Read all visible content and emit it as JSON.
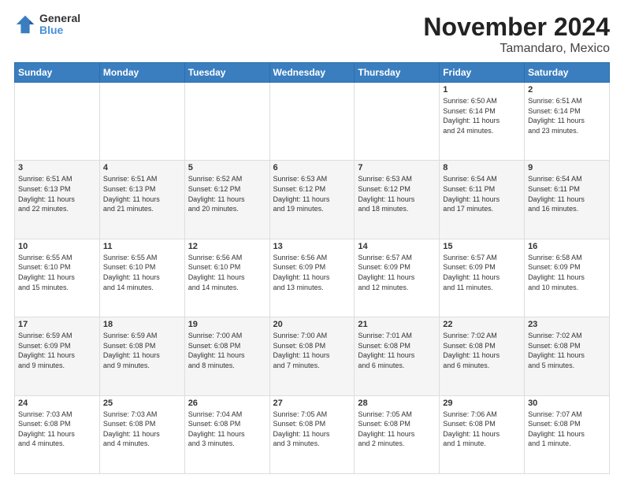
{
  "header": {
    "logo": {
      "general": "General",
      "blue": "Blue"
    },
    "title": "November 2024",
    "subtitle": "Tamandaro, Mexico"
  },
  "calendar": {
    "days_of_week": [
      "Sunday",
      "Monday",
      "Tuesday",
      "Wednesday",
      "Thursday",
      "Friday",
      "Saturday"
    ],
    "weeks": [
      [
        {
          "day": "",
          "info": ""
        },
        {
          "day": "",
          "info": ""
        },
        {
          "day": "",
          "info": ""
        },
        {
          "day": "",
          "info": ""
        },
        {
          "day": "",
          "info": ""
        },
        {
          "day": "1",
          "info": "Sunrise: 6:50 AM\nSunset: 6:14 PM\nDaylight: 11 hours\nand 24 minutes."
        },
        {
          "day": "2",
          "info": "Sunrise: 6:51 AM\nSunset: 6:14 PM\nDaylight: 11 hours\nand 23 minutes."
        }
      ],
      [
        {
          "day": "3",
          "info": "Sunrise: 6:51 AM\nSunset: 6:13 PM\nDaylight: 11 hours\nand 22 minutes."
        },
        {
          "day": "4",
          "info": "Sunrise: 6:51 AM\nSunset: 6:13 PM\nDaylight: 11 hours\nand 21 minutes."
        },
        {
          "day": "5",
          "info": "Sunrise: 6:52 AM\nSunset: 6:12 PM\nDaylight: 11 hours\nand 20 minutes."
        },
        {
          "day": "6",
          "info": "Sunrise: 6:53 AM\nSunset: 6:12 PM\nDaylight: 11 hours\nand 19 minutes."
        },
        {
          "day": "7",
          "info": "Sunrise: 6:53 AM\nSunset: 6:12 PM\nDaylight: 11 hours\nand 18 minutes."
        },
        {
          "day": "8",
          "info": "Sunrise: 6:54 AM\nSunset: 6:11 PM\nDaylight: 11 hours\nand 17 minutes."
        },
        {
          "day": "9",
          "info": "Sunrise: 6:54 AM\nSunset: 6:11 PM\nDaylight: 11 hours\nand 16 minutes."
        }
      ],
      [
        {
          "day": "10",
          "info": "Sunrise: 6:55 AM\nSunset: 6:10 PM\nDaylight: 11 hours\nand 15 minutes."
        },
        {
          "day": "11",
          "info": "Sunrise: 6:55 AM\nSunset: 6:10 PM\nDaylight: 11 hours\nand 14 minutes."
        },
        {
          "day": "12",
          "info": "Sunrise: 6:56 AM\nSunset: 6:10 PM\nDaylight: 11 hours\nand 14 minutes."
        },
        {
          "day": "13",
          "info": "Sunrise: 6:56 AM\nSunset: 6:09 PM\nDaylight: 11 hours\nand 13 minutes."
        },
        {
          "day": "14",
          "info": "Sunrise: 6:57 AM\nSunset: 6:09 PM\nDaylight: 11 hours\nand 12 minutes."
        },
        {
          "day": "15",
          "info": "Sunrise: 6:57 AM\nSunset: 6:09 PM\nDaylight: 11 hours\nand 11 minutes."
        },
        {
          "day": "16",
          "info": "Sunrise: 6:58 AM\nSunset: 6:09 PM\nDaylight: 11 hours\nand 10 minutes."
        }
      ],
      [
        {
          "day": "17",
          "info": "Sunrise: 6:59 AM\nSunset: 6:09 PM\nDaylight: 11 hours\nand 9 minutes."
        },
        {
          "day": "18",
          "info": "Sunrise: 6:59 AM\nSunset: 6:08 PM\nDaylight: 11 hours\nand 9 minutes."
        },
        {
          "day": "19",
          "info": "Sunrise: 7:00 AM\nSunset: 6:08 PM\nDaylight: 11 hours\nand 8 minutes."
        },
        {
          "day": "20",
          "info": "Sunrise: 7:00 AM\nSunset: 6:08 PM\nDaylight: 11 hours\nand 7 minutes."
        },
        {
          "day": "21",
          "info": "Sunrise: 7:01 AM\nSunset: 6:08 PM\nDaylight: 11 hours\nand 6 minutes."
        },
        {
          "day": "22",
          "info": "Sunrise: 7:02 AM\nSunset: 6:08 PM\nDaylight: 11 hours\nand 6 minutes."
        },
        {
          "day": "23",
          "info": "Sunrise: 7:02 AM\nSunset: 6:08 PM\nDaylight: 11 hours\nand 5 minutes."
        }
      ],
      [
        {
          "day": "24",
          "info": "Sunrise: 7:03 AM\nSunset: 6:08 PM\nDaylight: 11 hours\nand 4 minutes."
        },
        {
          "day": "25",
          "info": "Sunrise: 7:03 AM\nSunset: 6:08 PM\nDaylight: 11 hours\nand 4 minutes."
        },
        {
          "day": "26",
          "info": "Sunrise: 7:04 AM\nSunset: 6:08 PM\nDaylight: 11 hours\nand 3 minutes."
        },
        {
          "day": "27",
          "info": "Sunrise: 7:05 AM\nSunset: 6:08 PM\nDaylight: 11 hours\nand 3 minutes."
        },
        {
          "day": "28",
          "info": "Sunrise: 7:05 AM\nSunset: 6:08 PM\nDaylight: 11 hours\nand 2 minutes."
        },
        {
          "day": "29",
          "info": "Sunrise: 7:06 AM\nSunset: 6:08 PM\nDaylight: 11 hours\nand 1 minute."
        },
        {
          "day": "30",
          "info": "Sunrise: 7:07 AM\nSunset: 6:08 PM\nDaylight: 11 hours\nand 1 minute."
        }
      ]
    ]
  }
}
